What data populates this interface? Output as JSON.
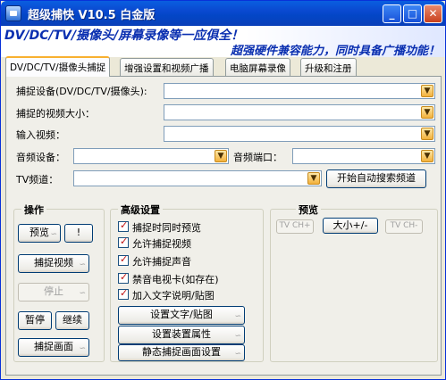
{
  "window": {
    "title": "超级捕快  V10.5  白金版",
    "controls": {
      "minimize": "_",
      "maximize": "□",
      "close": "✕"
    }
  },
  "banner": {
    "line1": "DV/DC/TV/摄像头/屏幕录像等一应俱全！",
    "line2": "超强硬件兼容能力，同时具备广播功能！"
  },
  "tabs": [
    {
      "label": "DV/DC/TV/摄像头捕捉",
      "active": true
    },
    {
      "label": "增强设置和视频广播",
      "active": false
    },
    {
      "label": "电脑屏幕录像",
      "active": false
    },
    {
      "label": "升级和注册",
      "active": false
    }
  ],
  "form": {
    "capture_device_label": "捕捉设备(DV/DC/TV/摄像头):",
    "video_size_label": "捕捉的视频大小：",
    "input_video_label": "输入视频：",
    "audio_device_label": "音频设备：",
    "audio_port_label": "音频端口：",
    "tv_channel_label": "TV频道：",
    "auto_search_button": "开始自动搜索频道",
    "capture_device_value": "",
    "video_size_value": "",
    "input_video_value": "",
    "audio_device_value": "",
    "audio_port_value": "",
    "tv_channel_value": ""
  },
  "operations": {
    "title": "操作",
    "preview_button": "预览",
    "help_button": "!",
    "capture_video_button": "捕捉视频",
    "stop_button": "停止",
    "pause_button": "暂停",
    "continue_button": "继续",
    "capture_frame_button": "捕捉画面"
  },
  "advanced": {
    "title": "高级设置",
    "checkboxes": [
      {
        "label": "捕捉时同时预览",
        "checked": true
      },
      {
        "label": "允许捕捉视频",
        "checked": true
      },
      {
        "label": "允许捕捉声音",
        "checked": true
      },
      {
        "label": "禁音电视卡(如存在)",
        "checked": true
      },
      {
        "label": "加入文字说明/贴图",
        "checked": true
      }
    ],
    "set_text_button": "设置文字/贴图",
    "device_props_button": "设置装置属性",
    "still_capture_button": "静态捕捉画面设置"
  },
  "preview": {
    "title": "预览",
    "tv_ch_plus": "TV CH+",
    "size_button": "大小+/-",
    "tv_ch_minus": "TV CH-"
  },
  "icons": {
    "dropdown": "chevron-down-icon",
    "app": "app-camera-icon"
  },
  "colors": {
    "titlebar": "#0a49d0",
    "banner_text": "#0a2fb0",
    "check_mark": "#c01010",
    "dropdown_button": "#f3b13c"
  }
}
